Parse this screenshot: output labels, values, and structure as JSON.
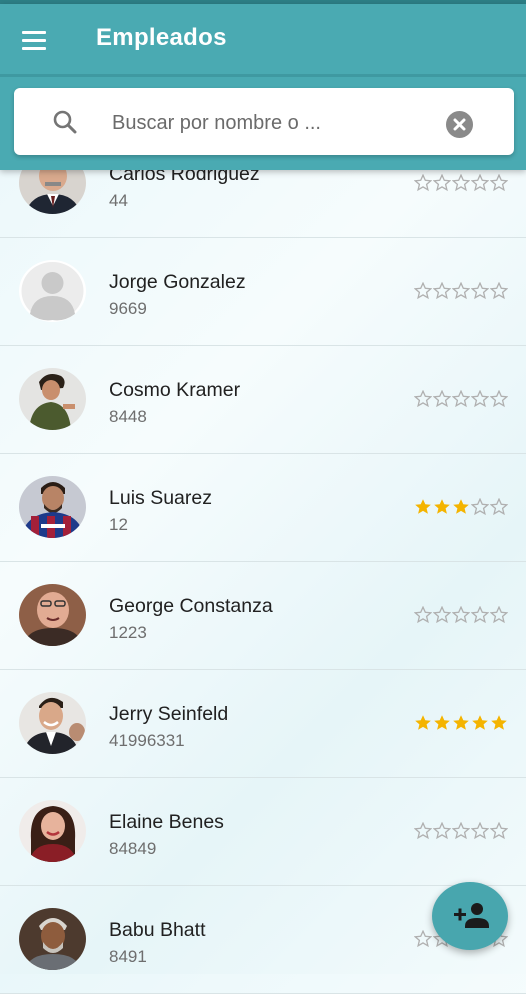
{
  "header": {
    "title": "Empleados",
    "menu_icon": "menu-icon"
  },
  "search": {
    "placeholder": "Buscar por nombre o ...",
    "value": ""
  },
  "colors": {
    "primary": "#4aaab2",
    "star_filled": "#f4b400",
    "star_empty": "#b0b0b0"
  },
  "employees": [
    {
      "name": "Carlos Rodriguez",
      "id": "44",
      "rating": 0
    },
    {
      "name": "Jorge Gonzalez",
      "id": "9669",
      "rating": 0
    },
    {
      "name": "Cosmo Kramer",
      "id": "8448",
      "rating": 0
    },
    {
      "name": "Luis Suarez",
      "id": "12",
      "rating": 3
    },
    {
      "name": "George Constanza",
      "id": "1223",
      "rating": 0
    },
    {
      "name": "Jerry Seinfeld",
      "id": "41996331",
      "rating": 5
    },
    {
      "name": "Elaine Benes",
      "id": "84849",
      "rating": 0
    },
    {
      "name": "Babu Bhatt",
      "id": "8491",
      "rating": 0
    }
  ],
  "fab": {
    "icon": "add-person-icon"
  }
}
